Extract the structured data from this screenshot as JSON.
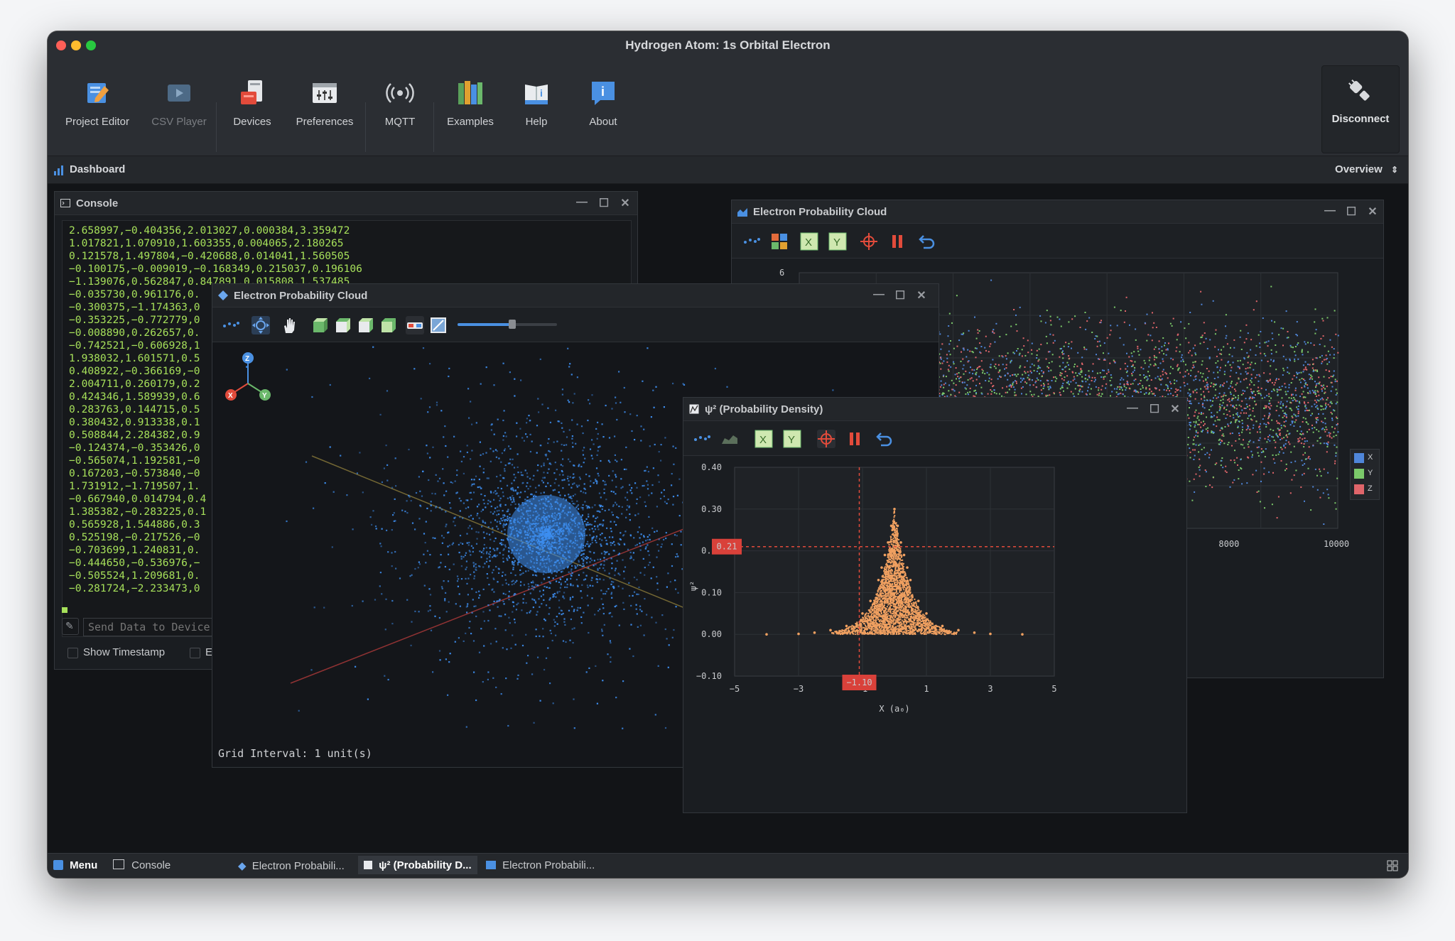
{
  "app": {
    "title": "Hydrogen Atom: 1s Orbital Electron",
    "toolbar": [
      {
        "label": "Project Editor",
        "icon": "project-editor-icon"
      },
      {
        "label": "CSV Player",
        "icon": "csv-player-icon"
      },
      {
        "label": "Devices",
        "icon": "devices-icon"
      },
      {
        "label": "Preferences",
        "icon": "preferences-icon"
      },
      {
        "label": "MQTT",
        "icon": "mqtt-icon"
      },
      {
        "label": "Examples",
        "icon": "examples-icon"
      },
      {
        "label": "Help",
        "icon": "help-icon"
      },
      {
        "label": "About",
        "icon": "about-icon"
      }
    ],
    "disconnect_label": "Disconnect"
  },
  "dashboard": {
    "label": "Dashboard",
    "view_selector": "Overview"
  },
  "console": {
    "title": "Console",
    "lines": [
      "2.658997,−0.404356,2.013027,0.000384,3.359472",
      "1.017821,1.070910,1.603355,0.004065,2.180265",
      "0.121578,1.497804,−0.420688,0.014041,1.560505",
      "−0.100175,−0.009019,−0.168349,0.215037,0.196106",
      "−1.139076,0.562847,0.847891,0.015808,1.537485",
      "−0.035730,0.961176,0.",
      "−0.300375,−1.174363,0",
      "−0.353225,−0.772779,0",
      "−0.008890,0.262657,0.",
      "−0.742521,−0.606928,1",
      "1.938032,1.601571,0.5",
      "0.408922,−0.366169,−0",
      "2.004711,0.260179,0.2",
      "0.424346,1.589939,0.6",
      "0.283763,0.144715,0.5",
      "0.380432,0.913338,0.1",
      "0.508844,2.284382,0.9",
      "−0.124374,−0.353426,0",
      "−0.565074,1.192581,−0",
      "0.167203,−0.573840,−0",
      "1.731912,−1.719507,1.",
      "−0.667940,0.014794,0.4",
      "1.385382,−0.283225,0.1",
      "0.565928,1.544886,0.3",
      "0.525198,−0.217526,−0",
      "−0.703699,1.240831,0.",
      "−0.444650,−0.536976,−",
      "−0.505524,1.209681,0.",
      "−0.281724,−2.233473,0"
    ],
    "input_placeholder": "Send Data to Device",
    "show_timestamp": "Show Timestamp",
    "echo_label": "Ec"
  },
  "cloud3d": {
    "title": "Electron Probability Cloud",
    "axes": {
      "x": "X",
      "y": "Y",
      "z": "Z"
    },
    "grid_interval": "Grid Interval: 1 unit(s)",
    "zoom_level": 0.55,
    "colors": {
      "points": "#3d8ef0"
    }
  },
  "multiplot": {
    "title": "Electron Probability Cloud",
    "y_tick_visible": "6",
    "x_ticks_visible": [
      "8000",
      "10000"
    ],
    "legend": [
      "X",
      "Y",
      "Z"
    ],
    "colors": {
      "x": "#4f86d9",
      "y": "#7bc96a",
      "z": "#e0656a"
    }
  },
  "density": {
    "title": "ψ² (Probability Density)",
    "ylabel": "ψ²",
    "xlabel": "X (a₀)",
    "cursor_y_label": "0.21",
    "cursor_x_label": "−1.10",
    "color": "#f0a060"
  },
  "chart_data": {
    "type": "scatter",
    "title": "ψ² (Probability Density)",
    "xlabel": "X (a₀)",
    "ylabel": "ψ²",
    "xlim": [
      -5,
      5
    ],
    "ylim": [
      -0.1,
      0.4
    ],
    "xticks": [
      "−5",
      "−3",
      "−1",
      "1",
      "3",
      "5"
    ],
    "yticks": [
      "0.40",
      "0.30",
      "0.20",
      "0.10",
      "0.00",
      "−0.10"
    ],
    "cursor": {
      "x": -1.1,
      "y": 0.21
    },
    "series": [
      {
        "x": [
          0,
          -0.1,
          0.1,
          -0.2,
          0.2,
          -0.3,
          0.3,
          -0.4,
          0.4,
          -0.5,
          0.5,
          -0.75,
          0.75,
          -1.0,
          1.0,
          -1.5,
          1.5,
          -2.0,
          2.0,
          -2.5,
          2.5,
          -3.0,
          3.0,
          -4.0,
          4.0
        ],
        "y": [
          0.3,
          0.26,
          0.26,
          0.22,
          0.22,
          0.19,
          0.19,
          0.16,
          0.16,
          0.13,
          0.13,
          0.08,
          0.08,
          0.05,
          0.05,
          0.02,
          0.02,
          0.01,
          0.01,
          0.004,
          0.004,
          0.001,
          0.001,
          0.0,
          0.0
        ]
      }
    ]
  },
  "taskbar": {
    "menu": "Menu",
    "items": [
      "Console",
      "Electron Probabili...",
      "ψ² (Probability D...",
      "Electron Probabili..."
    ]
  }
}
